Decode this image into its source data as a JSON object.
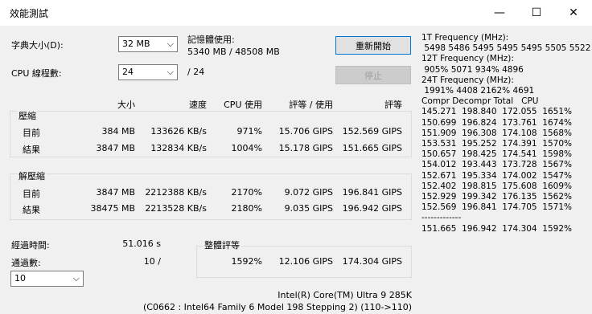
{
  "window": {
    "title": "效能測試",
    "minimize": "—",
    "maximize": "☐",
    "close": "✕"
  },
  "settings": {
    "dict_label": "字典大小(D):",
    "dict_value": "32 MB",
    "threads_label": "CPU 線程數:",
    "threads_value": "24",
    "threads_of": "/ 24",
    "mem_label": "記憶體使用:",
    "mem_value": "5340 MB / 48508 MB"
  },
  "buttons": {
    "restart": "重新開始",
    "stop": "停止"
  },
  "table": {
    "headers": [
      "大小",
      "速度",
      "CPU 使用",
      "評等 / 使用",
      "評等"
    ],
    "compress_title": "壓縮",
    "decompress_title": "解壓縮",
    "compress_rows": [
      {
        "label": "目前",
        "size": "384 MB",
        "speed": "133626 KB/s",
        "cpu": "971%",
        "rating_usage": "15.706 GIPS",
        "rating": "152.569 GIPS"
      },
      {
        "label": "結果",
        "size": "3847 MB",
        "speed": "132834 KB/s",
        "cpu": "1004%",
        "rating_usage": "15.178 GIPS",
        "rating": "151.665 GIPS"
      }
    ],
    "decompress_rows": [
      {
        "label": "目前",
        "size": "3847 MB",
        "speed": "2212388 KB/s",
        "cpu": "2170%",
        "rating_usage": "9.072 GIPS",
        "rating": "196.841 GIPS"
      },
      {
        "label": "結果",
        "size": "38475 MB",
        "speed": "2213528 KB/s",
        "cpu": "2180%",
        "rating_usage": "9.035 GIPS",
        "rating": "196.942 GIPS"
      }
    ]
  },
  "elapsed": {
    "label": "經過時間:",
    "value": "51.016 s"
  },
  "passes": {
    "label": "通過數:",
    "value": "10 /",
    "select_value": "10"
  },
  "overall": {
    "title": "整體評等",
    "cpu": "1592%",
    "rating_usage": "12.106 GIPS",
    "rating": "174.304 GIPS"
  },
  "cpu_info": {
    "line1": "Intel(R) Core(TM) Ultra 9 285K",
    "line2": "(C0662 : Intel64 Family 6 Model 198 Stepping 2) (110->110)"
  },
  "right_panel": {
    "lines": [
      "1T Frequency (MHz):",
      " 5498 5486 5495 5495 5495 5505 5522",
      "12T Frequency (MHz):",
      " 905% 5071 934% 4896",
      "24T Frequency (MHz):",
      " 1991% 4408 2162% 4691",
      "Compr Decompr Total   CPU",
      "145.271  198.840  172.055  1651%",
      "150.699  196.824  173.761  1674%",
      "151.909  196.308  174.108  1568%",
      "153.531  195.252  174.391  1570%",
      "150.657  198.425  174.541  1598%",
      "154.012  193.443  173.728  1567%",
      "152.671  195.334  174.002  1547%",
      "152.402  198.815  175.608  1609%",
      "152.929  199.342  176.135  1562%",
      "152.569  196.841  174.705  1571%",
      "-------------",
      "151.665  196.942  174.304  1592%"
    ]
  }
}
